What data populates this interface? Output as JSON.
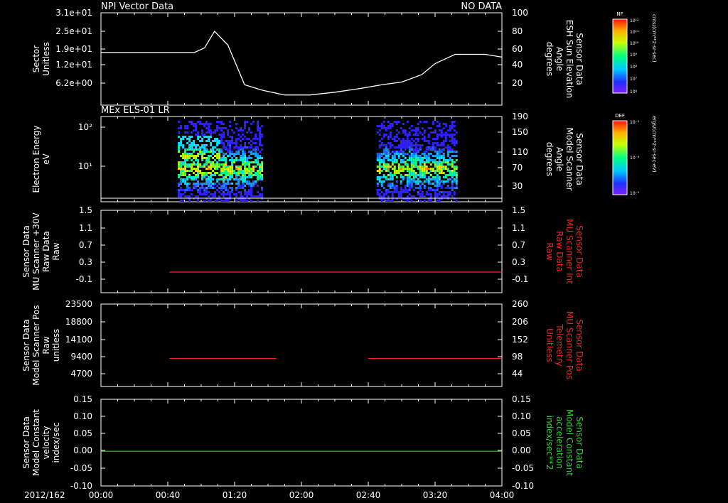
{
  "figure": {
    "panel1_title": "NPI Vector Data",
    "panel1_status": "NO DATA",
    "panel2_title": "MEx ELS-01 LR"
  },
  "colorbars": [
    {
      "header": "NF",
      "unit": "cnts/(cm**2-sr-sec)",
      "ticks": [
        "10¹²",
        "10¹¹",
        "10¹⁰",
        "10⁹",
        "10⁸",
        "10⁷",
        "10⁶"
      ]
    },
    {
      "header": "DEF",
      "unit": "ergs/(cm**2-sr-sec-eV)",
      "ticks": [
        "10⁻³",
        "10⁻⁴",
        "10⁻⁵"
      ]
    }
  ],
  "chart_data": [
    {
      "type": "line",
      "left_label": [
        "Sector",
        "Unitless"
      ],
      "right_label": [
        "Sensor Data",
        "ESH Sun Elevation",
        "Angle",
        "degrees"
      ],
      "yticks_left": [
        "3.1e+01",
        "2.5e+01",
        "1.9e+01",
        "1.2e+01",
        "6.2e+00"
      ],
      "yticks_right": [
        "100",
        "80",
        "60",
        "40",
        "20"
      ],
      "ylim_right": [
        0,
        100
      ],
      "series": [
        {
          "color": "#ffffff",
          "x_minutes": [
            0,
            56,
            62,
            68,
            76,
            86,
            97,
            110,
            125,
            140,
            155,
            168,
            180,
            192,
            200,
            212,
            230,
            240
          ],
          "values": [
            57,
            57,
            62,
            80,
            65,
            22,
            16,
            11,
            11,
            14,
            18,
            22,
            25,
            33,
            45,
            55,
            55,
            52
          ]
        }
      ]
    },
    {
      "type": "heatmap",
      "left_label": [
        "Electron Energy",
        "eV"
      ],
      "right_label": [
        "Sensor Data",
        "Model Scanner",
        "Angle",
        "degrees"
      ],
      "yticks_left": [
        "10²",
        "10¹"
      ],
      "yticks_right": [
        "190",
        "150",
        "110",
        "70",
        "30"
      ],
      "ylim_right": [
        0,
        190
      ],
      "x_blocks_minutes": [
        [
          46,
          96
        ],
        [
          165,
          213
        ]
      ],
      "baseline_right_value": 8
    },
    {
      "type": "line",
      "left_label": [
        "Sensor Data",
        "MU Scanner +30V",
        "Raw Data",
        "Raw"
      ],
      "right_label": [
        "Sensor Data",
        "MU Scanner Int",
        "Raw Data",
        "Raw"
      ],
      "yticks_left": [
        "1.5",
        "1.1",
        "0.7",
        "0.3",
        "-0.1"
      ],
      "yticks_right": [
        "1.5",
        "1.1",
        "0.7",
        "0.3",
        "-0.1"
      ],
      "ylim": [
        -0.5,
        1.5
      ],
      "series": [
        {
          "color": "#ff2020",
          "segments": [
            [
              [
                41,
                0
              ],
              [
                240,
                0
              ]
            ]
          ]
        }
      ]
    },
    {
      "type": "line",
      "left_label": [
        "Sensor Data",
        "Model Scanner Pos",
        "Raw",
        "unitless"
      ],
      "right_label": [
        "Sensor Data",
        "MU Scanner Pos",
        "Telemetry",
        "Unitless"
      ],
      "yticks_left": [
        "23500",
        "18800",
        "14100",
        "9400",
        "4700"
      ],
      "yticks_right": [
        "260",
        "206",
        "152",
        "98",
        "44"
      ],
      "ylim": [
        0,
        23500
      ],
      "series": [
        {
          "color": "#ff2020",
          "segments": [
            [
              [
                41,
                8000
              ],
              [
                105,
                8000
              ]
            ],
            [
              [
                160,
                8000
              ],
              [
                240,
                8000
              ]
            ]
          ]
        }
      ]
    },
    {
      "type": "line",
      "left_label": [
        "Sensor Data",
        "Model Constant",
        "velocity",
        "index/sec"
      ],
      "right_label": [
        "Sensor Data",
        "Model Constant",
        "acceleration",
        "index/sec**2"
      ],
      "yticks_left": [
        "0.15",
        "0.10",
        "0.05",
        "0.00",
        "-0.05",
        "-0.10"
      ],
      "yticks_right": [
        "0.15",
        "0.10",
        "0.05",
        "0.00",
        "-0.05",
        "-0.10"
      ],
      "ylim": [
        -0.1,
        0.15
      ],
      "series": [
        {
          "color": "#20e020",
          "segments": [
            [
              [
                0,
                0
              ],
              [
                240,
                0
              ]
            ]
          ]
        }
      ]
    }
  ],
  "xaxis": {
    "date_label": "2012/162",
    "ticks": [
      "00:00",
      "00:40",
      "01:20",
      "02:00",
      "02:40",
      "03:20",
      "04:00"
    ],
    "range_minutes": [
      0,
      240
    ]
  },
  "colors": {
    "axes": "#ffffff",
    "panel3_right": "#ff2020",
    "panel4_right": "#ff2020",
    "panel5_right": "#20e020"
  }
}
